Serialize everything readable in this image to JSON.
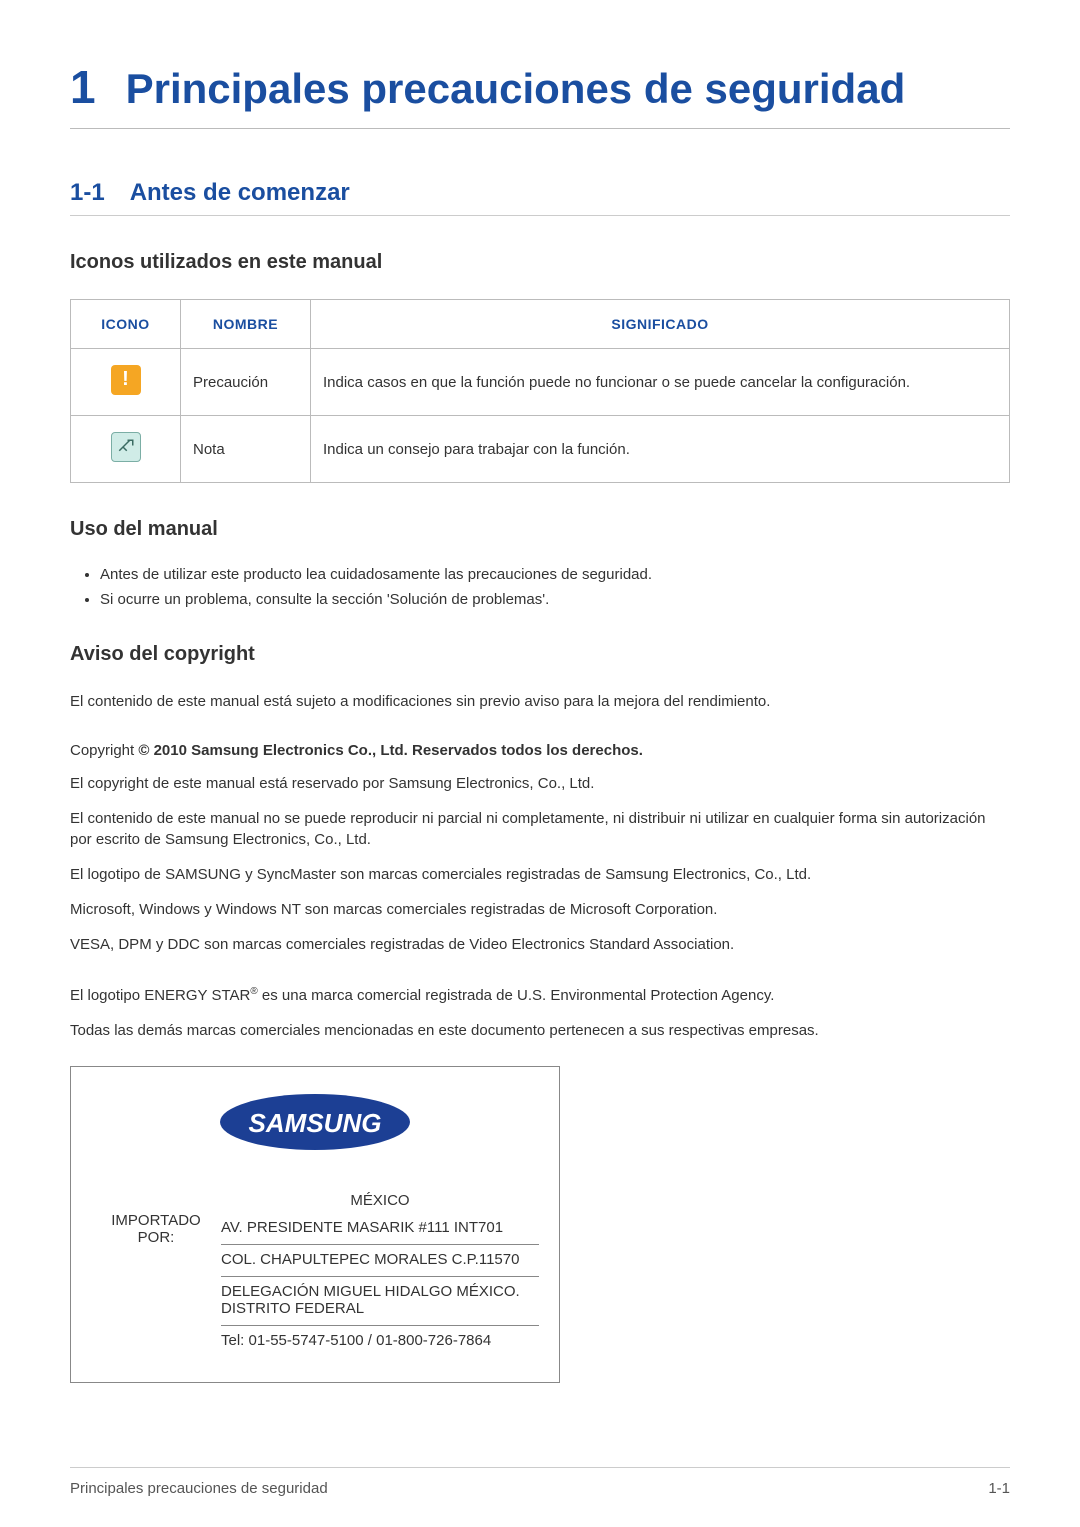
{
  "chapter": {
    "number": "1",
    "title": "Principales precauciones de seguridad"
  },
  "subsection": {
    "number": "1-1",
    "title": "Antes de comenzar"
  },
  "icons_heading": "Iconos utilizados en este manual",
  "icon_table": {
    "headers": {
      "icon": "ICONO",
      "name": "NOMBRE",
      "meaning": "SIGNIFICADO"
    },
    "rows": [
      {
        "name": "Precaución",
        "meaning": "Indica casos en que la función puede no funcionar o se puede cancelar la configuración."
      },
      {
        "name": "Nota",
        "meaning": "Indica un consejo para trabajar con la función."
      }
    ]
  },
  "usage_heading": "Uso del manual",
  "usage_bullets": [
    "Antes de utilizar este producto lea cuidadosamente las precauciones de seguridad.",
    "Si ocurre un problema, consulte la sección 'Solución de problemas'."
  ],
  "copyright_heading": "Aviso del copyright",
  "copyright_intro": "El contenido de este manual está sujeto a modificaciones sin previo aviso para la mejora del rendimiento.",
  "copyright_line_prefix": "Copyright ",
  "copyright_line_bold": "© 2010 Samsung Electronics Co., Ltd. Reservados todos los derechos.",
  "copyright_paragraphs": [
    "El copyright de este manual está reservado por Samsung Electronics, Co., Ltd.",
    "El contenido de este manual no se puede reproducir ni parcial ni completamente, ni distribuir ni utilizar en cualquier forma sin autorización por escrito de Samsung Electronics, Co., Ltd.",
    "El logotipo de SAMSUNG y SyncMaster son marcas comerciales registradas de Samsung Electronics, Co., Ltd.",
    "Microsoft, Windows y Windows NT son marcas comerciales registradas de Microsoft Corporation.",
    "VESA, DPM y DDC son marcas comerciales registradas de Video Electronics Standard Association."
  ],
  "energy_star_pre": "El logotipo ENERGY STAR",
  "energy_star_sup": "®",
  "energy_star_post": " es una marca comercial registrada de U.S. Environmental Protection Agency.",
  "trademarks_other": "Todas las demás marcas comerciales mencionadas en este documento pertenecen a sus respectivas empresas.",
  "import_box": {
    "logo_text": "SAMSUNG",
    "label": "IMPORTADO POR:",
    "country": "MÉXICO",
    "lines": [
      "AV. PRESIDENTE MASARIK #111 INT701",
      "COL. CHAPULTEPEC MORALES C.P.11570",
      "DELEGACIÓN MIGUEL HIDALGO MÉXICO. DISTRITO FEDERAL",
      "Tel: 01-55-5747-5100 / 01-800-726-7864"
    ]
  },
  "footer": {
    "left": "Principales precauciones de seguridad",
    "right": "1-1"
  }
}
